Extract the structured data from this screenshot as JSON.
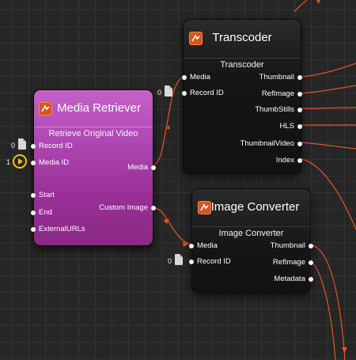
{
  "colors": {
    "wire": "#e9541f",
    "purple_node": "#a73fa9",
    "dark_node": "#1a1a1a"
  },
  "nodes": {
    "transcoder": {
      "title": "Transcoder",
      "subtitle": "Transcoder",
      "icon": "app-logo-icon",
      "inputs": [
        "Media",
        "Record ID"
      ],
      "outputs": [
        "Thumbnail",
        "RefImage",
        "ThumbStills",
        "HLS",
        "ThumbnailVideo",
        "Index"
      ]
    },
    "media_retriever": {
      "title": "Media Retriever",
      "subtitle": "Retrieve Original Video",
      "icon": "app-logo-icon",
      "inputs": [
        "Record ID",
        "Media ID",
        "Start",
        "End",
        "ExternalURLs"
      ],
      "outputs": [
        "Media",
        "Custom Image"
      ]
    },
    "image_converter": {
      "title": "Image Converter",
      "subtitle": "Image Converter",
      "icon": "app-logo-icon",
      "inputs": [
        "Media",
        "Record ID"
      ],
      "outputs": [
        "Thumbnail",
        "RefImage",
        "Metadata"
      ]
    }
  },
  "external_inputs": {
    "transcoder_record_id": {
      "value": "0",
      "icon": "document-icon"
    },
    "retriever_record_id": {
      "value": "0",
      "icon": "document-icon"
    },
    "retriever_media_id": {
      "value": "1",
      "icon": "play-icon"
    },
    "converter_record_id": {
      "value": "0",
      "icon": "document-icon"
    }
  }
}
